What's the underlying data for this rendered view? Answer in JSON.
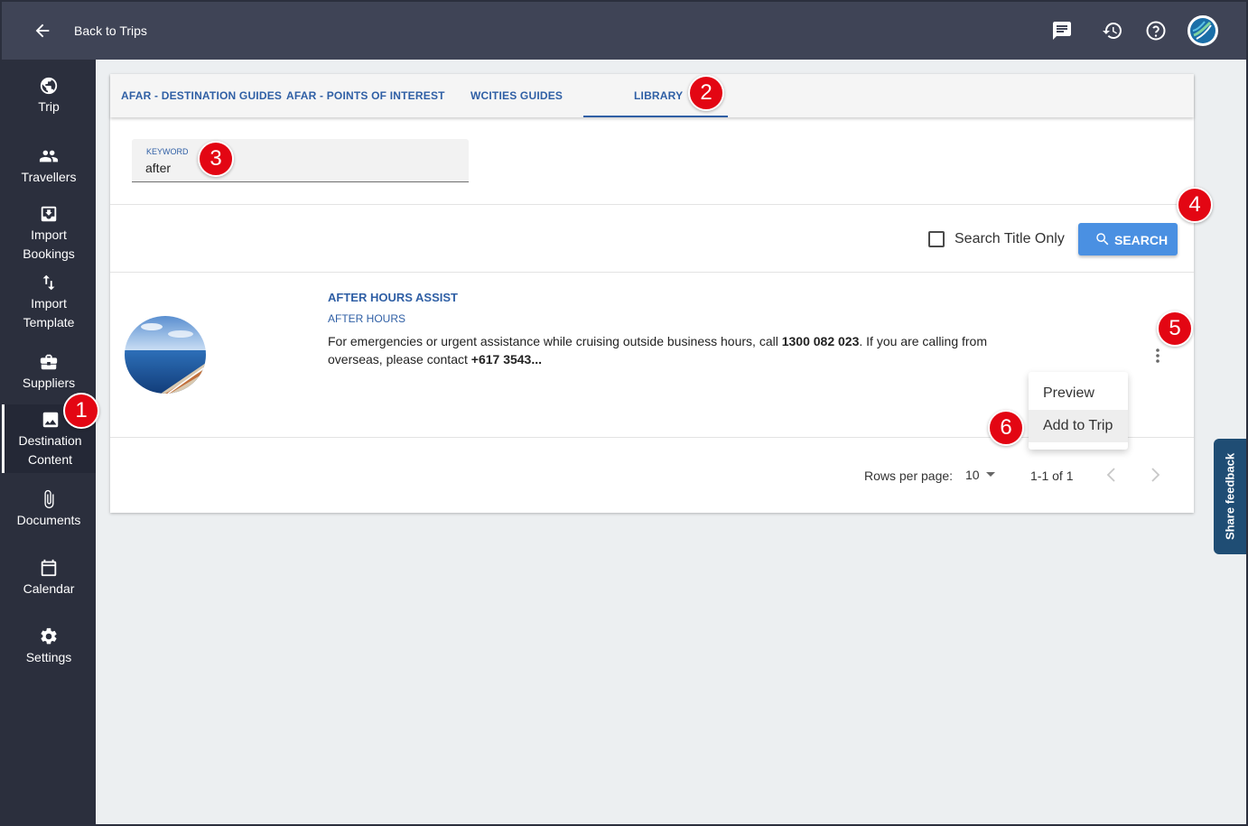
{
  "header": {
    "back_label": "Back to Trips",
    "icons": [
      "chat-icon",
      "history-icon",
      "help-icon",
      "avatar"
    ]
  },
  "sidebar": {
    "items": [
      {
        "label": "Trip",
        "icon": "globe-icon"
      },
      {
        "label": "Travellers",
        "icon": "people-icon"
      },
      {
        "label": "Import Bookings",
        "icon": "import-icon"
      },
      {
        "label": "Import Template",
        "icon": "swap-icon"
      },
      {
        "label": "Suppliers",
        "icon": "briefcase-icon"
      },
      {
        "label": "Destination Content",
        "icon": "image-icon",
        "active": true
      },
      {
        "label": "Documents",
        "icon": "paperclip-icon"
      },
      {
        "label": "Calendar",
        "icon": "calendar-icon"
      },
      {
        "label": "Settings",
        "icon": "gear-icon"
      }
    ]
  },
  "tabs": [
    {
      "label": "AFAR - DESTINATION GUIDES"
    },
    {
      "label": "AFAR - POINTS OF INTEREST"
    },
    {
      "label": "WCITIES GUIDES"
    },
    {
      "label": "LIBRARY",
      "active": true
    }
  ],
  "search": {
    "keyword_label": "KEYWORD",
    "keyword_value": "after",
    "title_only_label": "Search Title Only",
    "title_only_checked": false,
    "button_label": "SEARCH"
  },
  "results": [
    {
      "title": "AFTER HOURS ASSIST",
      "category": "AFTER HOURS",
      "body_1": "For emergencies or urgent assistance while cruising outside business hours, call ",
      "body_phone_1": "1300 082 023",
      "body_2": ". If you are calling from overseas, please contact ",
      "body_phone_2": "+617 3543..."
    }
  ],
  "pagination": {
    "rows_label": "Rows per page:",
    "rows_value": "10",
    "range": "1-1 of 1"
  },
  "menu": {
    "items": [
      {
        "label": "Preview"
      },
      {
        "label": "Add to Trip",
        "hover": true
      }
    ]
  },
  "feedback_label": "Share feedback",
  "markers": [
    "1",
    "2",
    "3",
    "4",
    "5",
    "6"
  ],
  "colors": {
    "topbar": "#3f4456",
    "sidebar": "#2b2f3d",
    "accent": "#2f5fa5",
    "button": "#4a90e2",
    "marker": "#e30613",
    "feedback": "#1f4d74"
  }
}
